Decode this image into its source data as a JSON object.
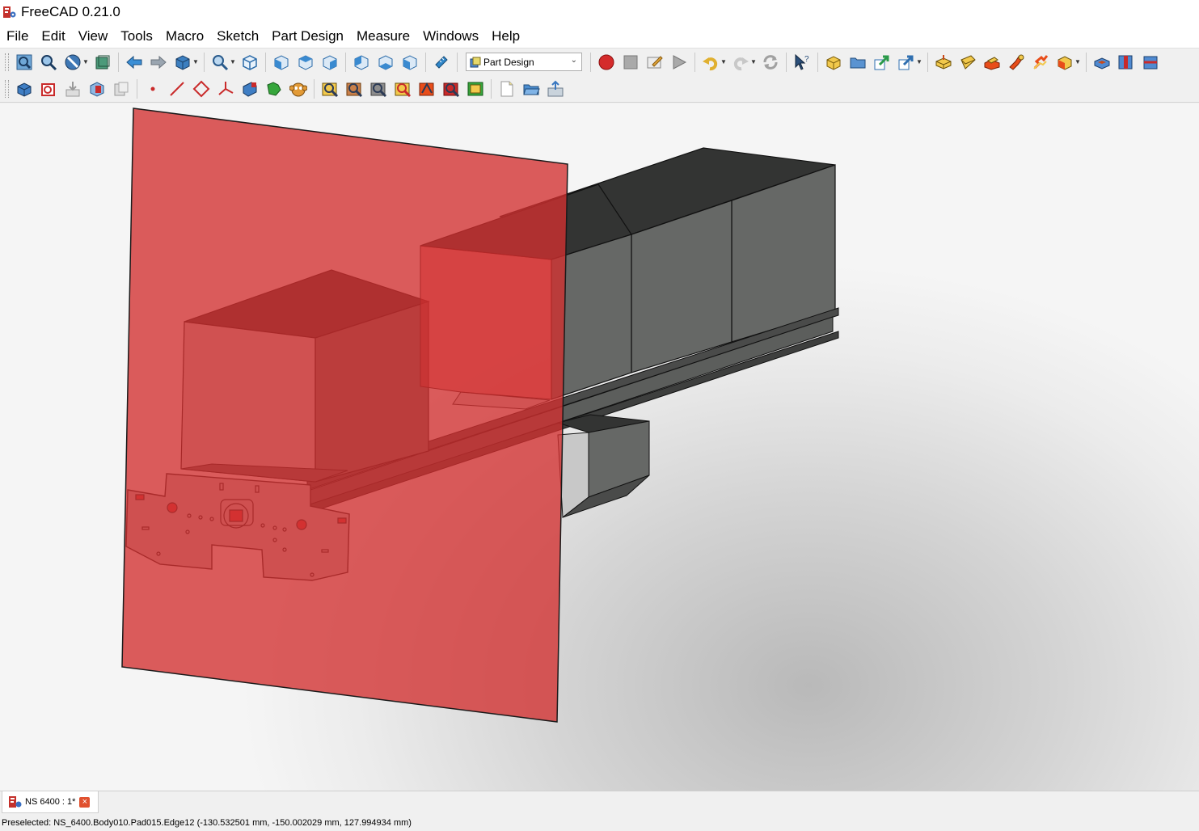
{
  "window": {
    "title": "FreeCAD 0.21.0"
  },
  "menu": [
    "File",
    "Edit",
    "View",
    "Tools",
    "Macro",
    "Sketch",
    "Part Design",
    "Measure",
    "Windows",
    "Help"
  ],
  "workbench_selector": {
    "selected": "Part Design"
  },
  "document_tab": {
    "label": "NS 6400 : 1*"
  },
  "status": {
    "text": "Preselected: NS_6400.Body010.Pad015.Edge12 (-130.532501 mm, -150.002029 mm, 127.994934 mm)"
  },
  "colors": {
    "plane": "#d22f2f",
    "box_front": "#c8c8c8",
    "box_side": "#6a6c6a",
    "box_top": "#373837",
    "accent_red": "#d42b2b"
  }
}
